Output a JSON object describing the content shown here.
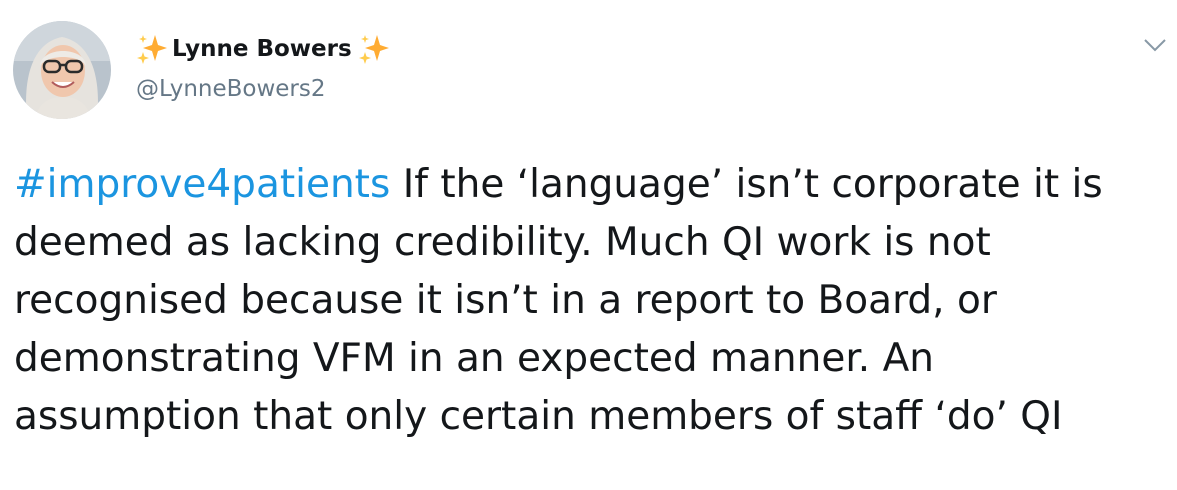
{
  "author": {
    "display_name": "Lynne Bowers",
    "handle": "@LynneBowers2",
    "name_decoration_icon": "sparkles-icon"
  },
  "menu_icon": "chevron-down-icon",
  "tweet": {
    "hashtag": "#improve4patients",
    "lines": [
      " If the ‘language’ isn’t corporate it is",
      "deemed as lacking credibility. Much QI work is not",
      "recognised because it isn’t in a report to Board, or",
      "demonstrating VFM in an expected manner. An",
      "assumption that only certain members of staff ‘do’ QI"
    ]
  },
  "colors": {
    "hashtag": "#1b95e0",
    "handle": "#657786",
    "text": "#14171a",
    "sparkle": "#ffac33"
  }
}
